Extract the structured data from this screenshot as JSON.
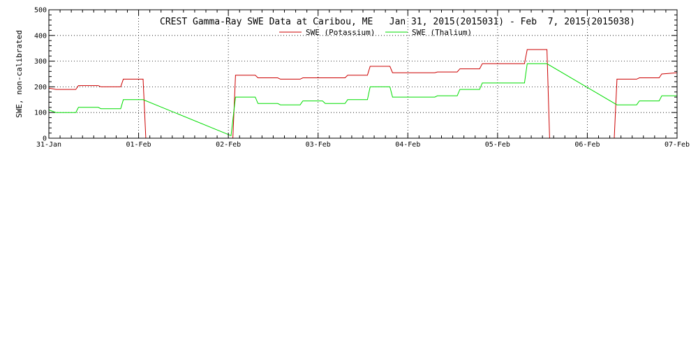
{
  "chart_data": {
    "type": "line",
    "title": "CREST Gamma-Ray SWE Data at Caribou, ME   Jan 31, 2015(2015031) - Feb  7, 2015(2015038)",
    "xlabel": "",
    "ylabel": "SWE, non-calibrated",
    "xlim": [
      0,
      7
    ],
    "ylim": [
      0,
      500
    ],
    "x_tick_labels": [
      "31-Jan",
      "01-Feb",
      "02-Feb",
      "03-Feb",
      "04-Feb",
      "05-Feb",
      "06-Feb",
      "07-Feb"
    ],
    "y_ticks": [
      0,
      100,
      200,
      300,
      400,
      500
    ],
    "grid": true,
    "legend_position": "top-center",
    "series": [
      {
        "name": "SWE (Potassium)",
        "color": "#cc0000",
        "x": [
          0.0,
          0.08,
          0.1,
          0.3,
          0.33,
          0.55,
          0.58,
          0.8,
          0.83,
          1.05,
          1.08,
          1.3,
          1.55,
          1.8,
          2.0,
          2.05,
          2.08,
          2.3,
          2.33,
          2.55,
          2.58,
          2.8,
          2.83,
          3.05,
          3.08,
          3.3,
          3.33,
          3.55,
          3.58,
          3.8,
          3.83,
          4.05,
          4.08,
          4.3,
          4.33,
          4.55,
          4.58,
          4.8,
          4.83,
          5.05,
          5.08,
          5.3,
          5.33,
          5.55,
          5.58,
          5.8,
          5.83,
          6.05,
          6.08,
          6.3,
          6.33,
          6.55,
          6.58,
          6.8,
          6.83,
          7.0
        ],
        "y": [
          195,
          190,
          190,
          190,
          205,
          205,
          200,
          200,
          230,
          230,
          0,
          0,
          0,
          0,
          0,
          0,
          245,
          245,
          235,
          235,
          230,
          230,
          235,
          235,
          235,
          235,
          245,
          245,
          280,
          280,
          255,
          255,
          255,
          255,
          258,
          258,
          270,
          270,
          290,
          290,
          290,
          290,
          345,
          345,
          0,
          0,
          0,
          0,
          0,
          0,
          230,
          230,
          235,
          235,
          250,
          255
        ]
      },
      {
        "name": "SWE (Thalium)",
        "color": "#00dd00",
        "x": [
          0.0,
          0.08,
          0.1,
          0.3,
          0.33,
          0.55,
          0.58,
          0.8,
          0.83,
          1.05,
          2.03,
          2.08,
          2.3,
          2.33,
          2.55,
          2.58,
          2.8,
          2.83,
          3.05,
          3.08,
          3.3,
          3.33,
          3.55,
          3.58,
          3.8,
          3.83,
          4.05,
          4.08,
          4.3,
          4.33,
          4.55,
          4.58,
          4.8,
          4.83,
          5.05,
          5.08,
          5.3,
          5.33,
          5.55,
          6.33,
          6.55,
          6.58,
          6.8,
          6.83,
          7.0
        ],
        "y": [
          110,
          100,
          100,
          100,
          120,
          120,
          115,
          115,
          150,
          150,
          10,
          160,
          160,
          135,
          135,
          130,
          130,
          145,
          145,
          135,
          135,
          150,
          150,
          200,
          200,
          160,
          160,
          160,
          160,
          165,
          165,
          190,
          190,
          215,
          215,
          215,
          215,
          290,
          290,
          130,
          130,
          145,
          145,
          165,
          165
        ]
      }
    ]
  }
}
